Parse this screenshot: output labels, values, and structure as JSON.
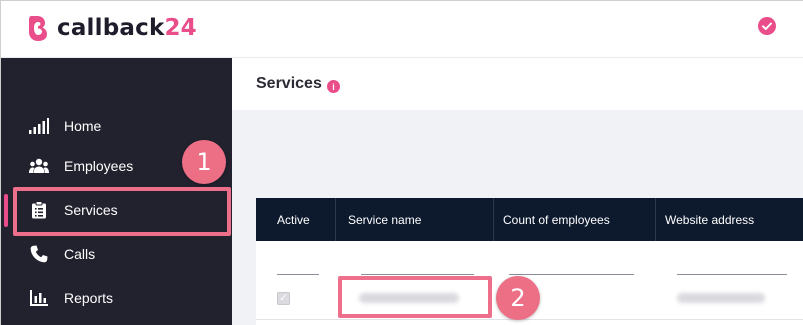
{
  "app": {
    "brand_name": "callback",
    "brand_suffix": "24",
    "brand_color": "#e94d8a"
  },
  "sidebar": {
    "background": "#22212e",
    "items": [
      {
        "label": "Home",
        "icon": "signal-bars-icon"
      },
      {
        "label": "Employees",
        "icon": "users-icon"
      },
      {
        "label": "Services",
        "icon": "clipboard-icon",
        "active": true
      },
      {
        "label": "Calls",
        "icon": "phone-icon"
      },
      {
        "label": "Reports",
        "icon": "bar-chart-icon"
      }
    ]
  },
  "main": {
    "title": "Services",
    "info_symbol": "i",
    "table": {
      "columns": [
        "Active",
        "Service name",
        "Count of employees",
        "Website address"
      ],
      "rows": [
        {
          "active": true
        }
      ]
    }
  },
  "annotations": {
    "step1": "1",
    "step2": "2",
    "highlight_color": "#ee6f8c"
  }
}
